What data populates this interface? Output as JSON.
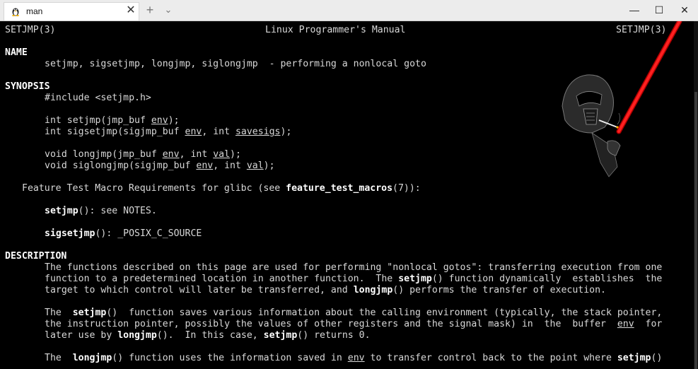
{
  "window": {
    "tab_title": "man",
    "tab_icon": "linux-penguin-icon",
    "close_tab_label": "✕",
    "new_tab_label": "+",
    "dropdown_label": "⌄",
    "minimize_label": "—",
    "maximize_label": "☐",
    "close_label": "✕"
  },
  "manpage": {
    "header_left": "SETJMP(3)",
    "header_center": "Linux Programmer's Manual",
    "header_right": "SETJMP(3)",
    "name_heading": "NAME",
    "name_line": "setjmp, sigsetjmp, longjmp, siglongjmp  - performing a nonlocal goto",
    "synopsis_heading": "SYNOPSIS",
    "include": "#include <setjmp.h>",
    "proto1_a": "int setjmp(jmp_buf ",
    "proto1_arg": "env",
    "proto1_b": ");",
    "proto2_a": "int sigsetjmp(sigjmp_buf ",
    "proto2_arg1": "env",
    "proto2_b": ", int ",
    "proto2_arg2": "savesigs",
    "proto2_c": ");",
    "proto3_a": "void longjmp(jmp_buf ",
    "proto3_arg1": "env",
    "proto3_b": ", int ",
    "proto3_arg2": "val",
    "proto3_c": ");",
    "proto4_a": "void siglongjmp(sigjmp_buf ",
    "proto4_arg1": "env",
    "proto4_b": ", int ",
    "proto4_arg2": "val",
    "proto4_c": ");",
    "ftm_a": "Feature Test Macro Requirements for glibc (see ",
    "ftm_bold": "feature_test_macros",
    "ftm_b": "(7)):",
    "ftm1_bold": "setjmp",
    "ftm1_rest": "(): see NOTES.",
    "ftm2_bold": "sigsetjmp",
    "ftm2_rest": "(): _POSIX_C_SOURCE",
    "description_heading": "DESCRIPTION",
    "d1": "The functions described on this page are used for performing \"nonlocal gotos\": transferring execution from one",
    "d2_a": "function to a predetermined location in another function.  The ",
    "d2_bold": "setjmp",
    "d2_b": "() function dynamically  establishes  the",
    "d3_a": "target to which control will later be transferred, and ",
    "d3_bold": "longjmp",
    "d3_b": "() performs the transfer of execution.",
    "d4_a": "The  ",
    "d4_bold": "setjmp",
    "d4_b": "()  function saves various information about the calling environment (typically, the stack pointer,",
    "d5_a": "the instruction pointer, possibly the values of other registers and the signal mask) in  the  buffer  ",
    "d5_ul": "env",
    "d5_b": "  for",
    "d6_a": "later use by ",
    "d6_bold1": "longjmp",
    "d6_b": "().  In this case, ",
    "d6_bold2": "setjmp",
    "d6_c": "() returns 0.",
    "d7_a": "The  ",
    "d7_bold": "longjmp",
    "d7_b": "() function uses the information saved in ",
    "d7_ul": "env",
    "d7_c": " to transfer control back to the point where ",
    "d7_bold2": "setjmp",
    "d7_d": "()"
  }
}
